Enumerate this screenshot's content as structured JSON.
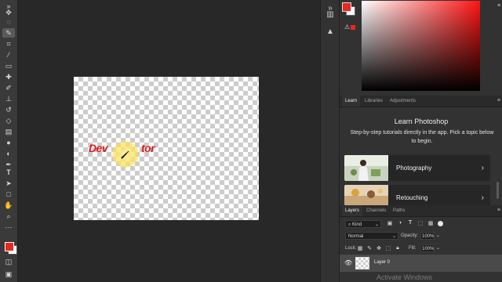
{
  "toolbar": {
    "tools": [
      "move",
      "marquee",
      "lasso",
      "object-select",
      "crop",
      "frame",
      "eyedropper",
      "healing",
      "brush",
      "clone-stamp",
      "history-brush",
      "eraser",
      "gradient",
      "blur",
      "dodge",
      "pen",
      "type",
      "path-select",
      "rectangle",
      "hand",
      "zoom",
      "more"
    ]
  },
  "canvas": {
    "text_left": "Dev",
    "text_right": "tor"
  },
  "color_panel": {
    "foreground": "#e82820",
    "background": "#ffffff"
  },
  "learn_panel": {
    "tabs": [
      "Learn",
      "Libraries",
      "Adjustments"
    ],
    "active_tab": "Learn",
    "title": "Learn Photoshop",
    "description": "Step-by-step tutorials directly in the app. Pick a topic below to begin.",
    "cards": [
      {
        "label": "Photography"
      },
      {
        "label": "Retouching"
      }
    ]
  },
  "layers_panel": {
    "tabs": [
      "Layers",
      "Channels",
      "Paths"
    ],
    "active_tab": "Layers",
    "kind_label": "Kind",
    "blend_mode": "Normal",
    "opacity_label": "Opacity:",
    "opacity_value": "100%",
    "lock_label": "Lock:",
    "fill_label": "Fill:",
    "fill_value": "100%",
    "layers": [
      {
        "name": "Layer 0"
      }
    ]
  },
  "watermark": "Activate Windows"
}
